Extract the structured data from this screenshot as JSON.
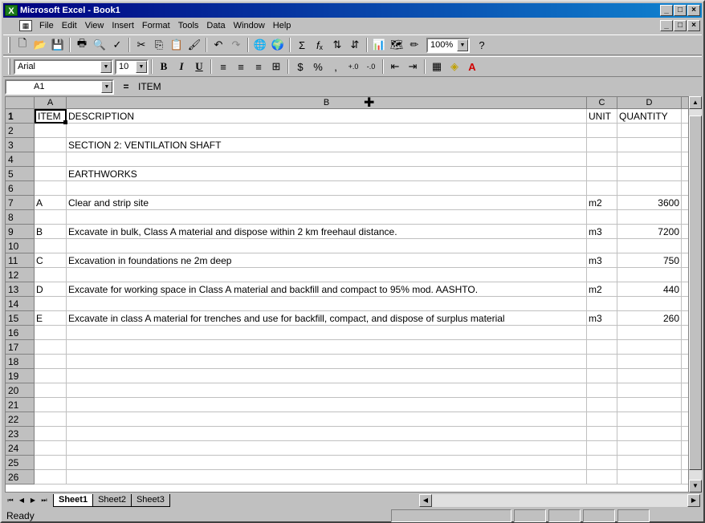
{
  "window": {
    "title": "Microsoft Excel - Book1",
    "controls": [
      "_",
      "□",
      "×"
    ]
  },
  "menu": {
    "items": [
      "File",
      "Edit",
      "View",
      "Insert",
      "Format",
      "Tools",
      "Data",
      "Window",
      "Help"
    ],
    "doc_controls": [
      "_",
      "□",
      "×"
    ]
  },
  "toolbar_standard": {
    "zoom": "100%"
  },
  "toolbar_formatting": {
    "font": "Arial",
    "size": "10"
  },
  "formula_bar": {
    "name_box": "A1",
    "equals": "=",
    "value": "ITEM"
  },
  "columns": [
    {
      "label": "A"
    },
    {
      "label": "B"
    },
    {
      "label": "C"
    },
    {
      "label": "D"
    }
  ],
  "rows": [
    {
      "num": "1",
      "cells": [
        "ITEM",
        "DESCRIPTION",
        "UNIT",
        "QUANTITY"
      ]
    },
    {
      "num": "2",
      "cells": [
        "",
        "",
        "",
        ""
      ]
    },
    {
      "num": "3",
      "cells": [
        "",
        "SECTION 2: VENTILATION SHAFT",
        "",
        ""
      ]
    },
    {
      "num": "4",
      "cells": [
        "",
        "",
        "",
        ""
      ]
    },
    {
      "num": "5",
      "cells": [
        "",
        "EARTHWORKS",
        "",
        ""
      ]
    },
    {
      "num": "6",
      "cells": [
        "",
        "",
        "",
        ""
      ]
    },
    {
      "num": "7",
      "cells": [
        "A",
        "Clear and strip site",
        "m2",
        "3600"
      ]
    },
    {
      "num": "8",
      "cells": [
        "",
        "",
        "",
        ""
      ]
    },
    {
      "num": "9",
      "cells": [
        "B",
        "Excavate in bulk, Class A material and dispose within 2 km freehaul distance.",
        "m3",
        "7200"
      ]
    },
    {
      "num": "10",
      "cells": [
        "",
        "",
        "",
        ""
      ]
    },
    {
      "num": "11",
      "cells": [
        "C",
        "Excavation in foundations ne 2m deep",
        "m3",
        "750"
      ]
    },
    {
      "num": "12",
      "cells": [
        "",
        "",
        "",
        ""
      ]
    },
    {
      "num": "13",
      "cells": [
        "D",
        "Excavate for working space in Class A material and backfill and compact to 95% mod. AASHTO.",
        "m2",
        "440"
      ]
    },
    {
      "num": "14",
      "cells": [
        "",
        "",
        "",
        ""
      ]
    },
    {
      "num": "15",
      "cells": [
        "E",
        "Excavate in class A material for trenches and use for backfill, compact, and dispose of surplus material",
        "m3",
        "260"
      ]
    },
    {
      "num": "16",
      "cells": [
        "",
        "",
        "",
        ""
      ]
    },
    {
      "num": "17",
      "cells": [
        "",
        "",
        "",
        ""
      ]
    },
    {
      "num": "18",
      "cells": [
        "",
        "",
        "",
        ""
      ]
    },
    {
      "num": "19",
      "cells": [
        "",
        "",
        "",
        ""
      ]
    },
    {
      "num": "20",
      "cells": [
        "",
        "",
        "",
        ""
      ]
    },
    {
      "num": "21",
      "cells": [
        "",
        "",
        "",
        ""
      ]
    },
    {
      "num": "22",
      "cells": [
        "",
        "",
        "",
        ""
      ]
    },
    {
      "num": "23",
      "cells": [
        "",
        "",
        "",
        ""
      ]
    },
    {
      "num": "24",
      "cells": [
        "",
        "",
        "",
        ""
      ]
    },
    {
      "num": "25",
      "cells": [
        "",
        "",
        "",
        ""
      ]
    },
    {
      "num": "26",
      "cells": [
        "",
        "",
        "",
        ""
      ]
    }
  ],
  "sheets": [
    "Sheet1",
    "Sheet2",
    "Sheet3"
  ],
  "active_sheet": "Sheet1",
  "status": {
    "text": "Ready"
  }
}
